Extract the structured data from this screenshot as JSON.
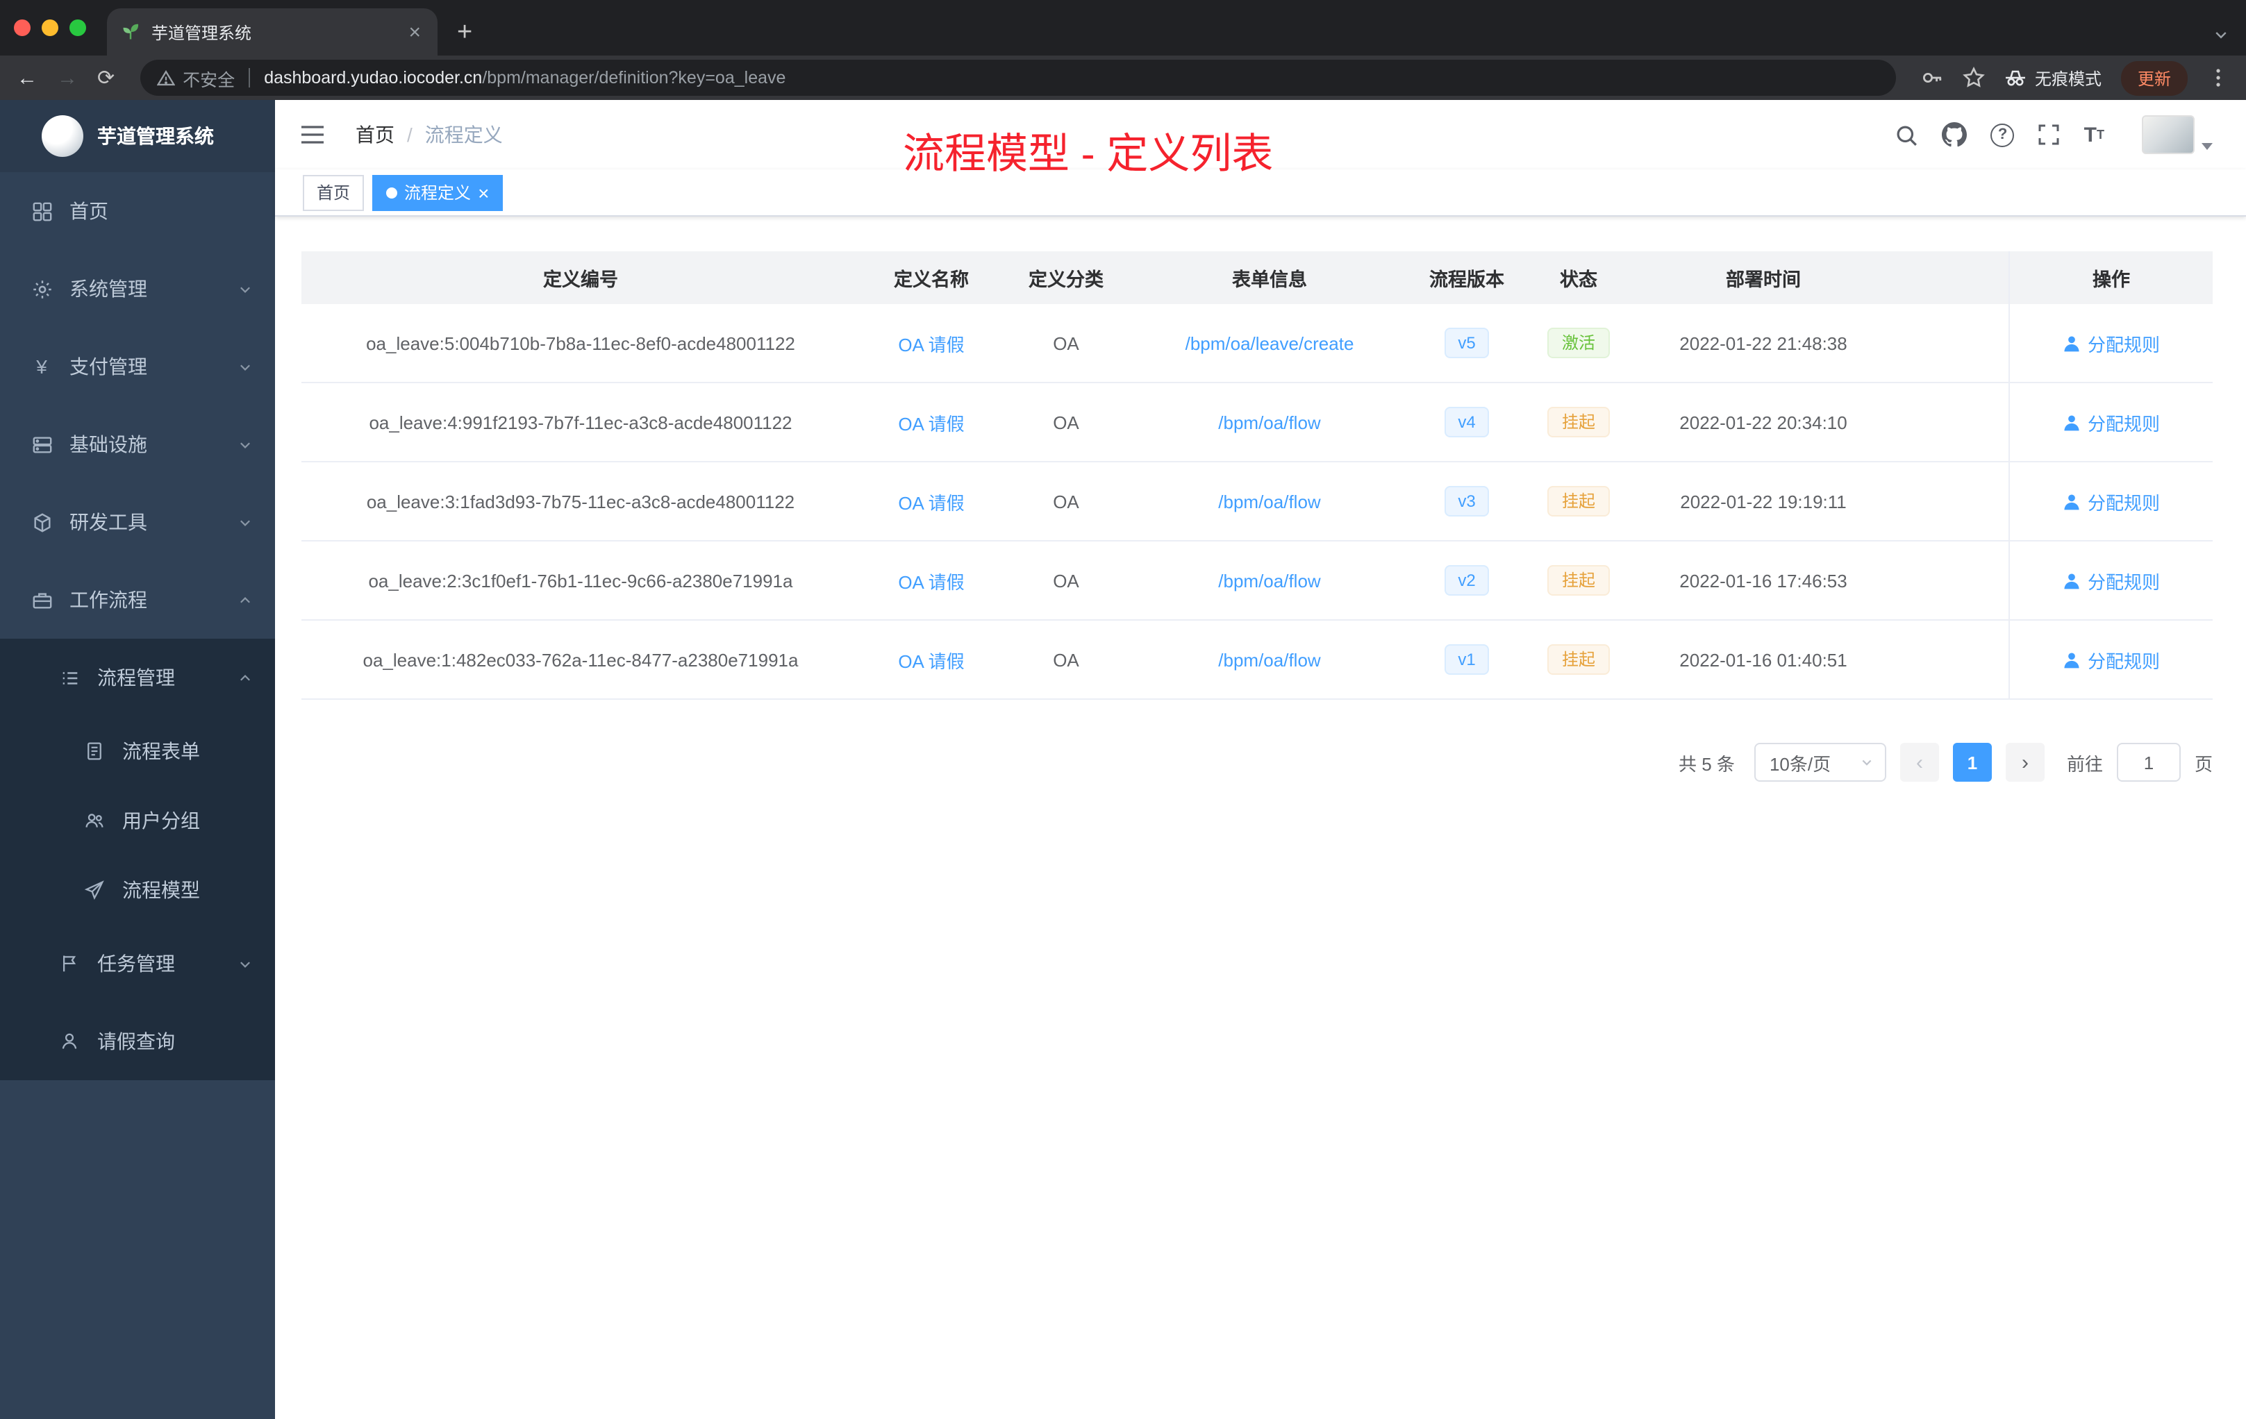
{
  "colors": {
    "primary": "#409eff",
    "success": "#67c23a",
    "warning": "#e6a23c",
    "title_red": "#f5222d",
    "sidebar_bg": "#304156"
  },
  "browser": {
    "tab_title": "芋道管理系统",
    "security_label": "不安全",
    "url_host": "dashboard.yudao.iocoder.cn",
    "url_path": "/bpm/manager/definition?key=oa_leave",
    "incognito_label": "无痕模式",
    "update_label": "更新"
  },
  "sidebar": {
    "logo_title": "芋道管理系统",
    "items": [
      {
        "label": "首页",
        "icon": "dashboard-icon"
      },
      {
        "label": "系统管理",
        "icon": "gear-icon"
      },
      {
        "label": "支付管理",
        "icon": "yen-icon"
      },
      {
        "label": "基础设施",
        "icon": "server-icon"
      },
      {
        "label": "研发工具",
        "icon": "cube-icon"
      },
      {
        "label": "工作流程",
        "icon": "briefcase-icon"
      },
      {
        "label": "流程管理",
        "icon": "list-icon"
      },
      {
        "label": "流程表单",
        "icon": "form-icon"
      },
      {
        "label": "用户分组",
        "icon": "user-group-icon"
      },
      {
        "label": "流程模型",
        "icon": "paper-plane-icon"
      },
      {
        "label": "任务管理",
        "icon": "flag-icon"
      },
      {
        "label": "请假查询",
        "icon": "person-icon"
      }
    ]
  },
  "header": {
    "breadcrumb_home": "首页",
    "breadcrumb_current": "流程定义",
    "overlay_title": "流程模型 - 定义列表"
  },
  "tags": {
    "home_tag": "首页",
    "active_tag": "流程定义"
  },
  "table": {
    "columns": [
      "定义编号",
      "定义名称",
      "定义分类",
      "表单信息",
      "流程版本",
      "状态",
      "部署时间",
      "操作"
    ],
    "rows": [
      {
        "id": "oa_leave:5:004b710b-7b8a-11ec-8ef0-acde48001122",
        "name": "OA 请假",
        "category": "OA",
        "form": "/bpm/oa/leave/create",
        "version": "v5",
        "status": "激活",
        "status_type": "success",
        "deploy_time": "2022-01-22 21:48:38",
        "action": "分配规则"
      },
      {
        "id": "oa_leave:4:991f2193-7b7f-11ec-a3c8-acde48001122",
        "name": "OA 请假",
        "category": "OA",
        "form": "/bpm/oa/flow",
        "version": "v4",
        "status": "挂起",
        "status_type": "warning",
        "deploy_time": "2022-01-22 20:34:10",
        "action": "分配规则"
      },
      {
        "id": "oa_leave:3:1fad3d93-7b75-11ec-a3c8-acde48001122",
        "name": "OA 请假",
        "category": "OA",
        "form": "/bpm/oa/flow",
        "version": "v3",
        "status": "挂起",
        "status_type": "warning",
        "deploy_time": "2022-01-22 19:19:11",
        "action": "分配规则"
      },
      {
        "id": "oa_leave:2:3c1f0ef1-76b1-11ec-9c66-a2380e71991a",
        "name": "OA 请假",
        "category": "OA",
        "form": "/bpm/oa/flow",
        "version": "v2",
        "status": "挂起",
        "status_type": "warning",
        "deploy_time": "2022-01-16 17:46:53",
        "action": "分配规则"
      },
      {
        "id": "oa_leave:1:482ec033-762a-11ec-8477-a2380e71991a",
        "name": "OA 请假",
        "category": "OA",
        "form": "/bpm/oa/flow",
        "version": "v1",
        "status": "挂起",
        "status_type": "warning",
        "deploy_time": "2022-01-16 01:40:51",
        "action": "分配规则"
      }
    ]
  },
  "pagination": {
    "total_label": "共 5 条",
    "page_size": "10条/页",
    "prev": "‹",
    "next": "›",
    "current_page": "1",
    "goto_label": "前往",
    "goto_value": "1",
    "page_unit": "页"
  }
}
